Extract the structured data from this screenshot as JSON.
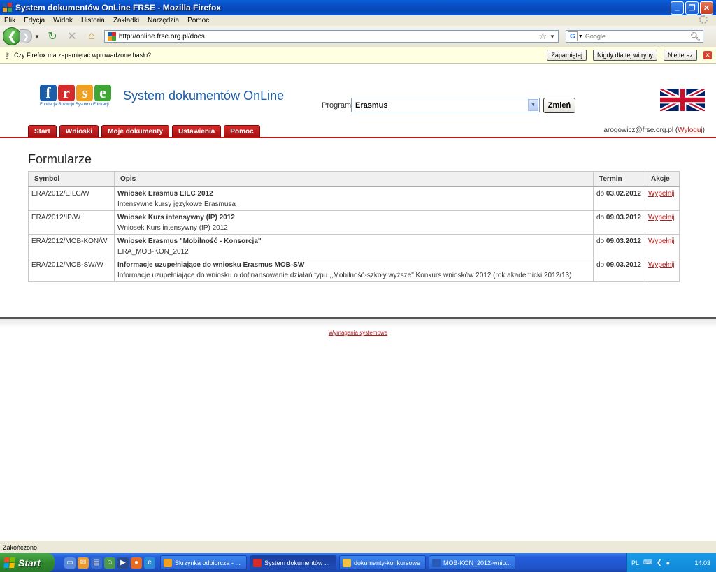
{
  "window": {
    "title": "System dokumentów OnLine FRSE - Mozilla Firefox",
    "minimize": "_",
    "maximize": "❐",
    "close": "✕"
  },
  "menu": {
    "items": [
      "Plik",
      "Edycja",
      "Widok",
      "Historia",
      "Zakładki",
      "Narzędzia",
      "Pomoc"
    ]
  },
  "navbar": {
    "back": "❮",
    "forward": "❯",
    "url": "http://online.frse.org.pl/docs",
    "search_placeholder": "Google"
  },
  "notification": {
    "message": "Czy Firefox ma zapamiętać wprowadzone hasło?",
    "remember": "Zapamiętaj",
    "never": "Nigdy dla tej witryny",
    "not_now": "Nie teraz"
  },
  "site": {
    "logo_letters": [
      "f",
      "r",
      "s",
      "e"
    ],
    "logo_colors": [
      "#1b5da8",
      "#d42b2b",
      "#f0a020",
      "#3fa535"
    ],
    "logo_tagline": "Fundacja Rozwoju Systemu Edukacji",
    "title": "System dokumentów OnLine",
    "program_label": "Program",
    "program_value": "Erasmus",
    "change_button": "Zmień",
    "tabs": [
      "Start",
      "Wnioski",
      "Moje dokumenty",
      "Ustawienia",
      "Pomoc"
    ],
    "user_email": "arogowicz@frse.org.pl",
    "logout": "Wyloguj",
    "section_title": "Formularze",
    "table": {
      "headers": [
        "Symbol",
        "Opis",
        "Termin",
        "Akcje"
      ],
      "rows": [
        {
          "symbol": "ERA/2012/EILC/W",
          "title": "Wniosek Erasmus EILC 2012",
          "desc": "Intensywne kursy językowe Erasmusa",
          "deadline_prefix": "do",
          "deadline": "03.02.2012",
          "action": "Wypełnij"
        },
        {
          "symbol": "ERA/2012/IP/W",
          "title": "Wniosek Kurs intensywny (IP) 2012",
          "desc": "Wniosek Kurs intensywny (IP) 2012",
          "deadline_prefix": "do",
          "deadline": "09.03.2012",
          "action": "Wypełnij"
        },
        {
          "symbol": "ERA/2012/MOB-KON/W",
          "title": "Wniosek Erasmus \"Mobilność - Konsorcja\"",
          "desc": "ERA_MOB-KON_2012",
          "deadline_prefix": "do",
          "deadline": "09.03.2012",
          "action": "Wypełnij"
        },
        {
          "symbol": "ERA/2012/MOB-SW/W",
          "title": "Informacje uzupełniające do wniosku Erasmus MOB-SW",
          "desc": "Informacje uzupełniające do wniosku o dofinansowanie działań typu ,,Mobilność-szkoły wyższe\" Konkurs wniosków 2012 (rok akademicki 2012/13)",
          "deadline_prefix": "do",
          "deadline": "09.03.2012",
          "action": "Wypełnij"
        }
      ]
    },
    "system_requirements": "Wymagania systemowe"
  },
  "status": {
    "text": "Zakończono"
  },
  "taskbar": {
    "start": "Start",
    "tasks": [
      {
        "label": "Skrzynka odbiorcza - ...",
        "color": "#f0a020",
        "active": false
      },
      {
        "label": "System dokumentów ...",
        "color": "#d42b2b",
        "active": true
      },
      {
        "label": "dokumenty-konkursowe",
        "color": "#f0c040",
        "active": false
      },
      {
        "label": "MOB-KON_2012-wnio...",
        "color": "#2a5ab8",
        "active": false
      }
    ],
    "language": "PL",
    "clock": "14:03"
  }
}
